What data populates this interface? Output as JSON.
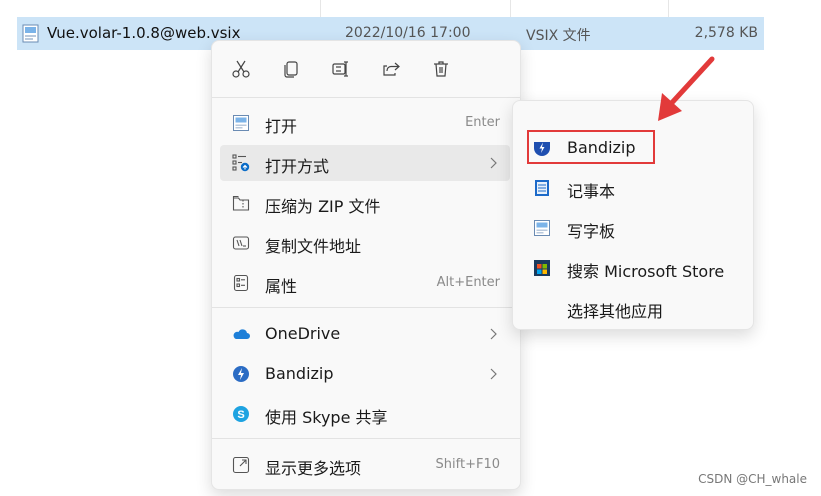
{
  "file": {
    "name": "Vue.volar-1.0.8@web.vsix",
    "date": "2022/10/16 17:00",
    "type": "VSIX 文件",
    "size": "2,578 KB"
  },
  "toolbar": {
    "cut_icon": "scissors-icon",
    "copy_icon": "copy-icon",
    "rename_icon": "rename-icon",
    "share_icon": "share-icon",
    "delete_icon": "trash-icon"
  },
  "menu": {
    "items": [
      {
        "label": "打开",
        "shortcut": "Enter",
        "icon": "open-icon"
      },
      {
        "label": "打开方式",
        "shortcut": "",
        "icon": "open-with-icon"
      },
      {
        "label": "压缩为 ZIP 文件",
        "shortcut": "",
        "icon": "zip-icon"
      },
      {
        "label": "复制文件地址",
        "shortcut": "",
        "icon": "copy-path-icon"
      },
      {
        "label": "属性",
        "shortcut": "Alt+Enter",
        "icon": "properties-icon"
      },
      {
        "label": "OneDrive",
        "shortcut": "",
        "icon": "onedrive-icon"
      },
      {
        "label": "Bandizip",
        "shortcut": "",
        "icon": "bandizip-icon"
      },
      {
        "label": "使用 Skype 共享",
        "shortcut": "",
        "icon": "skype-icon"
      },
      {
        "label": "显示更多选项",
        "shortcut": "Shift+F10",
        "icon": "more-options-icon"
      }
    ]
  },
  "submenu": {
    "items": [
      {
        "label": "Bandizip",
        "icon": "bandizip-app-icon"
      },
      {
        "label": "记事本",
        "icon": "notepad-icon"
      },
      {
        "label": "写字板",
        "icon": "wordpad-icon"
      },
      {
        "label": "搜索 Microsoft Store",
        "icon": "store-icon"
      },
      {
        "label": "选择其他应用",
        "icon": ""
      }
    ]
  },
  "colors": {
    "selection": "#cce4f7",
    "highlight": "#e23a3a",
    "accent": "#0a6cc8"
  },
  "watermark": "CSDN @CH_whale"
}
